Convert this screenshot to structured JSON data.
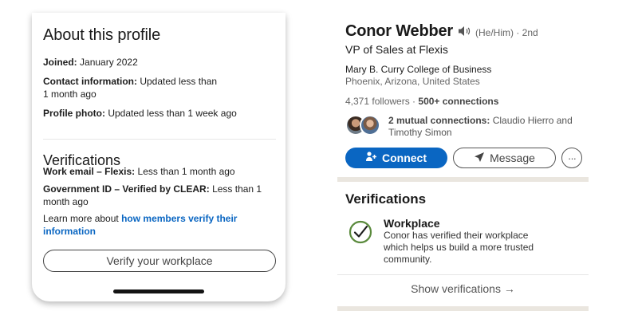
{
  "about_panel": {
    "title": "About this profile",
    "joined_label": "Joined:",
    "joined_value": "January 2022",
    "contact_label": "Contact information:",
    "contact_value_line1": "Updated less than",
    "contact_value_line2": "1 month ago",
    "photo_label": "Profile photo:",
    "photo_value": "Updated less than 1 week ago",
    "verifications_title": "Verifications",
    "work_email_label": "Work email – Flexis:",
    "work_email_value": "Less than 1 month ago",
    "gov_id_label": "Government ID – Verified by CLEAR:",
    "gov_id_value_line1": "Less than 1",
    "gov_id_value_line2": "month ago",
    "learn_more_prefix": "Learn more about",
    "learn_more_link_line1": "how members verify their",
    "learn_more_link_line2": "information",
    "verify_button": "Verify your workplace"
  },
  "profile_card": {
    "name": "Conor Webber",
    "speaker_icon": "speaker-icon",
    "pronouns_degree": "(He/Him) · 2nd",
    "headline": "VP of Sales at Flexis",
    "school": "Mary B. Curry College of Business",
    "location": "Phoenix, Arizona, United States",
    "followers": "4,371 followers",
    "stats_separator": " · ",
    "connections": "500+ connections",
    "mutual_count": "2 mutual connections:",
    "mutual_names": "Claudio Hierro and",
    "mutual_names_line2": "Timothy Simon",
    "connect_button": "Connect",
    "message_button": "Message",
    "more_button": "···",
    "verifications_title": "Verifications",
    "workplace_title": "Workplace",
    "workplace_desc_line1": "Conor has verified their workplace",
    "workplace_desc_line2": "which helps us build a more trusted",
    "workplace_desc_line3": "community.",
    "show_verifications": "Show verifications →"
  },
  "colors": {
    "brand_blue": "#0a66c2",
    "verified_green": "#5a8a3c",
    "separator_band": "#eae6df"
  }
}
